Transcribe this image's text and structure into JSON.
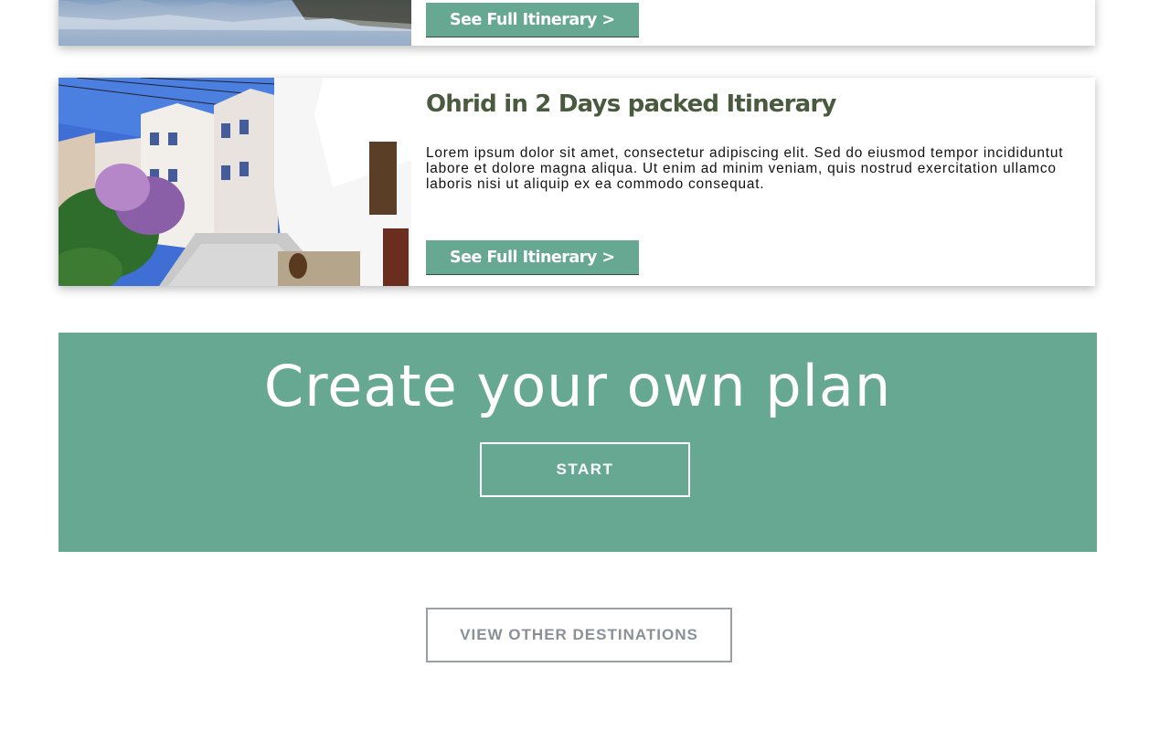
{
  "previous_card": {
    "button_label": "See Full Itinerary >",
    "image": "lake-reflection-photo"
  },
  "itinerary_card": {
    "title": "Ohrid in 2 Days packed Itinerary",
    "description": "Lorem ipsum dolor sit amet, consectetur adipiscing elit. Sed do eiusmod tempor incididuntut labore et dolore magna aliqua. Ut enim ad minim veniam, quis nostrud exercitation ullamco laboris nisi ut aliquip ex ea commodo consequat.",
    "button_label": "See Full Itinerary >",
    "image": "old-town-street-photo"
  },
  "cta": {
    "title": "Create your own plan",
    "button_label": "START"
  },
  "footer": {
    "button_label": "VIEW OTHER DESTINATIONS"
  },
  "colors": {
    "accent": "#66a891",
    "title": "#4a5a3e",
    "secondary_text": "#8a9096"
  }
}
